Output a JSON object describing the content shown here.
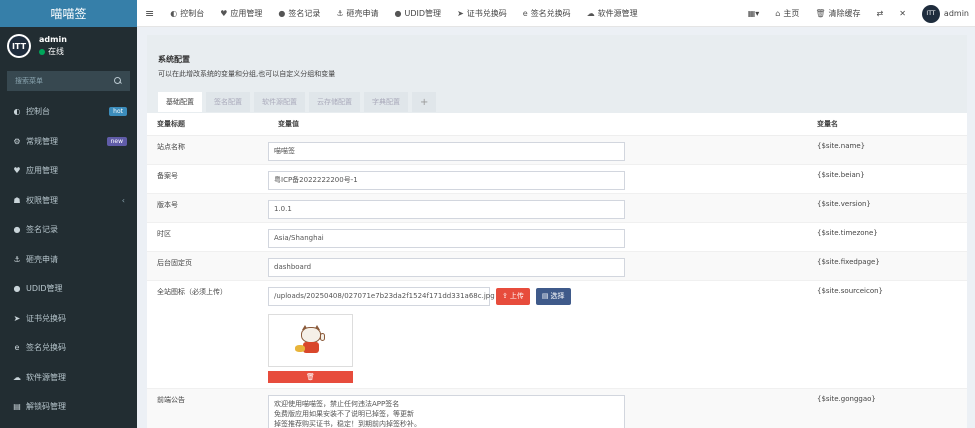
{
  "sidebar": {
    "logo": "喵喵签",
    "user": {
      "name": "admin",
      "status": "在线",
      "avatar_text": "ITT"
    },
    "search_placeholder": "搜索菜单",
    "items": [
      {
        "label": "控制台",
        "icon": "dashboard-icon",
        "glyph": "◐",
        "badge": "hot"
      },
      {
        "label": "常规管理",
        "icon": "cogs-icon",
        "glyph": "⚙",
        "badge": "new"
      },
      {
        "label": "应用管理",
        "icon": "heart-icon",
        "glyph": "♥"
      },
      {
        "label": "权限管理",
        "icon": "users-icon",
        "glyph": "☗",
        "caret": "‹"
      },
      {
        "label": "签名记录",
        "icon": "record-icon",
        "glyph": "●"
      },
      {
        "label": "砸壳申请",
        "icon": "anchor-icon",
        "glyph": "⚓"
      },
      {
        "label": "UDID管理",
        "icon": "apple-icon",
        "glyph": "●"
      },
      {
        "label": "证书兑换码",
        "icon": "send-icon",
        "glyph": "➤"
      },
      {
        "label": "签名兑换码",
        "icon": "edge-icon",
        "glyph": "e"
      },
      {
        "label": "软件源管理",
        "icon": "cloud-icon",
        "glyph": "☁"
      },
      {
        "label": "解锁码管理",
        "icon": "card-icon",
        "glyph": "▤"
      }
    ]
  },
  "topnav": {
    "menu_glyph": "≡",
    "items": [
      {
        "label": "控制台",
        "glyph": "◐"
      },
      {
        "label": "应用管理",
        "glyph": "♥"
      },
      {
        "label": "签名记录",
        "glyph": "●"
      },
      {
        "label": "砸壳申请",
        "glyph": "⚓"
      },
      {
        "label": "UDID管理",
        "glyph": "●"
      },
      {
        "label": "证书兑换码",
        "glyph": "➤"
      },
      {
        "label": "签名兑换码",
        "glyph": "e"
      },
      {
        "label": "软件源管理",
        "glyph": "☁"
      }
    ],
    "right": {
      "grid_glyph": "▦▾",
      "home": "主页",
      "home_glyph": "⌂",
      "clear_cache": "清除缓存",
      "clear_glyph": "🗑",
      "translate_glyph": "⇄",
      "fullscreen_glyph": "✕",
      "avatar_text": "ITT",
      "user": "admin"
    }
  },
  "panel": {
    "title": "系统配置",
    "desc": "可以在此增改系统的变量和分组,也可以自定义分组和变量",
    "tabs": [
      "基础配置",
      "签名配置",
      "软件源配置",
      "云存储配置",
      "字典配置"
    ],
    "add_tab": "+",
    "columns": [
      "变量标题",
      "变量值",
      "变量名"
    ],
    "rows": [
      {
        "title": "站点名称",
        "value": "喵喵签",
        "name": "{$site.name}"
      },
      {
        "title": "备案号",
        "value": "粤ICP备2022222200号-1",
        "name": "{$site.beian}"
      },
      {
        "title": "版本号",
        "value": "1.0.1",
        "name": "{$site.version}"
      },
      {
        "title": "时区",
        "value": "Asia/Shanghai",
        "name": "{$site.timezone}"
      },
      {
        "title": "后台固定页",
        "value": "dashboard",
        "name": "{$site.fixedpage}"
      }
    ],
    "icon_row": {
      "title": "全站图标（必须上传）",
      "value": "/uploads/20250408/027071e7b23da2f1524f171dd331a68c.jpg",
      "upload_label": "上传",
      "select_label": "选择",
      "delete_glyph": "🗑",
      "name": "{$site.sourceicon}"
    },
    "notice_row": {
      "title": "前端公告",
      "lines": [
        "欢迎使用喵喵签，禁止任何违法APP签名",
        "免费版应用如果安装不了说明已掉签，等更新",
        "掉签推荐购买证书，稳定！到期前内掉签秒补。"
      ],
      "name": "{$site.gonggao}"
    }
  }
}
